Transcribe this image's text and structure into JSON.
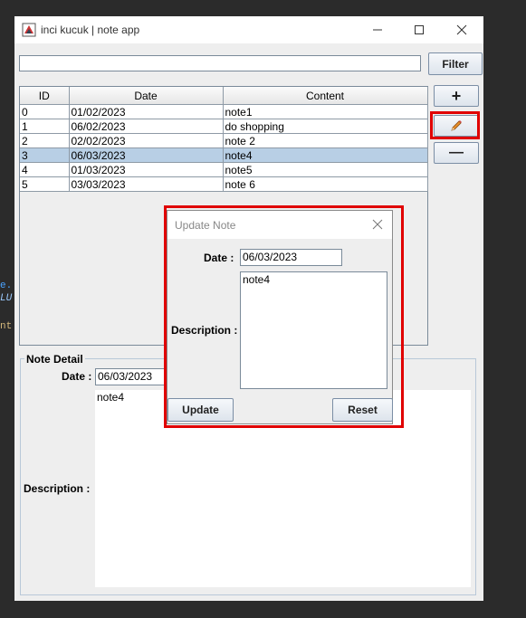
{
  "window": {
    "title": "inci kucuk | note app"
  },
  "filter": {
    "value": "",
    "button_label": "Filter"
  },
  "table": {
    "headers": [
      "ID",
      "Date",
      "Content"
    ],
    "rows": [
      {
        "id": "0",
        "date": "01/02/2023",
        "content": "note1"
      },
      {
        "id": "1",
        "date": "06/02/2023",
        "content": "do shopping"
      },
      {
        "id": "2",
        "date": "02/02/2023",
        "content": "note 2"
      },
      {
        "id": "3",
        "date": "06/03/2023",
        "content": "note4"
      },
      {
        "id": "4",
        "date": "01/03/2023",
        "content": "note5"
      },
      {
        "id": "5",
        "date": "03/03/2023",
        "content": "note 6"
      }
    ],
    "selected_index": 3
  },
  "side_buttons": {
    "add_label": "+",
    "remove_label": "—"
  },
  "detail": {
    "legend": "Note Detail",
    "date_label": "Date :",
    "date_value": "06/03/2023",
    "description_label": "Description :",
    "description_value": "note4"
  },
  "dialog": {
    "title": "Update Note",
    "date_label": "Date :",
    "date_value": "06/03/2023",
    "description_label": "Description :",
    "description_value": "note4",
    "update_label": "Update",
    "reset_label": "Reset"
  },
  "background_code": [
    "e.",
    "LU",
    "nt"
  ],
  "colors": {
    "highlight": "#e00000",
    "selection": "#b8cfe5",
    "code_blue": "#4aa3ff",
    "code_yellow": "#d7ba7d"
  }
}
